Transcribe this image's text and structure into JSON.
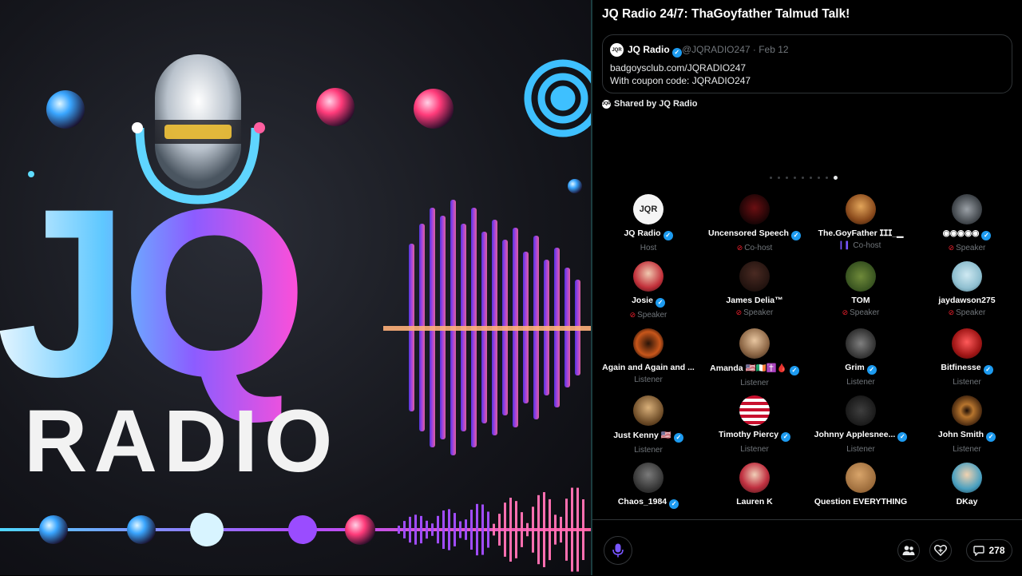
{
  "space": {
    "title": "JQ Radio 24/7: ThaGoyfather Talmud Talk!"
  },
  "artwork": {
    "logo_letters": "JQ",
    "logo_word": "RADIO"
  },
  "tweet": {
    "avatar_text": "JQR",
    "author": "JQ Radio",
    "handle_date": "@JQRADIO247 · Feb 12",
    "line1": "badgoysclub.com/JQRADIO247",
    "line2": "With coupon code: JQRADIO247"
  },
  "shared_by": "Shared by JQ Radio",
  "pager": {
    "count": 9,
    "active": 8
  },
  "participants": [
    {
      "name": "JQ Radio",
      "role": "Host",
      "verified": true,
      "role_icon": "none",
      "avatar": "jqr"
    },
    {
      "name": "Uncensored Speech",
      "role": "Co-host",
      "verified": true,
      "role_icon": "mute",
      "avatar": "dark-red"
    },
    {
      "name": "The.GoyFather ⵊⵊⵊ_▁",
      "role": "Co-host",
      "verified": false,
      "role_icon": "wave",
      "avatar": "king"
    },
    {
      "name": "◉◉◉◉◉",
      "role": "Speaker",
      "verified": true,
      "role_icon": "mute",
      "avatar": "helmet"
    },
    {
      "name": "Josie",
      "role": "Speaker",
      "verified": true,
      "role_icon": "mute",
      "avatar": "josie"
    },
    {
      "name": "James Delia™",
      "role": "Speaker",
      "verified": false,
      "role_icon": "mute",
      "avatar": "james"
    },
    {
      "name": "TOM",
      "role": "Speaker",
      "verified": false,
      "role_icon": "mute",
      "avatar": "tom"
    },
    {
      "name": "jaydawson275",
      "role": "Speaker",
      "verified": false,
      "role_icon": "mute",
      "avatar": "jay"
    },
    {
      "name": "Again and Again and ...",
      "role": "Listener",
      "verified": false,
      "role_icon": "none",
      "avatar": "hsg"
    },
    {
      "name": "Amanda 🇺🇸🇮🇪✝️🩸",
      "role": "Listener",
      "verified": true,
      "role_icon": "none",
      "avatar": "amanda"
    },
    {
      "name": "Grim",
      "role": "Listener",
      "verified": true,
      "role_icon": "none",
      "avatar": "grim"
    },
    {
      "name": "Bitfinesse",
      "role": "Listener",
      "verified": true,
      "role_icon": "none",
      "avatar": "bit"
    },
    {
      "name": "Just Kenny 🇺🇸",
      "role": "Listener",
      "verified": true,
      "role_icon": "none",
      "avatar": "kenny"
    },
    {
      "name": "Timothy Piercy",
      "role": "Listener",
      "verified": true,
      "role_icon": "none",
      "avatar": "flag"
    },
    {
      "name": "Johnny Applesnee...",
      "role": "Listener",
      "verified": true,
      "role_icon": "none",
      "avatar": "johnny"
    },
    {
      "name": "John Smith",
      "role": "Listener",
      "verified": true,
      "role_icon": "none",
      "avatar": "eye"
    },
    {
      "name": "Chaos_1984",
      "role": "",
      "verified": true,
      "role_icon": "none",
      "avatar": "chaos"
    },
    {
      "name": "Lauren K",
      "role": "",
      "verified": false,
      "role_icon": "none",
      "avatar": "lauren"
    },
    {
      "name": "Question EVERYTHING",
      "role": "",
      "verified": false,
      "role_icon": "none",
      "avatar": "cookie"
    },
    {
      "name": "DKay",
      "role": "",
      "verified": false,
      "role_icon": "none",
      "avatar": "dkay"
    }
  ],
  "bottom_bar": {
    "reply_count": "278",
    "icons": [
      "mic-icon",
      "people-icon",
      "heart-plus-icon",
      "comment-icon"
    ]
  },
  "colors": {
    "accent": "#1d9bf0",
    "mute": "#f4212e",
    "wave": "#7856ff"
  }
}
